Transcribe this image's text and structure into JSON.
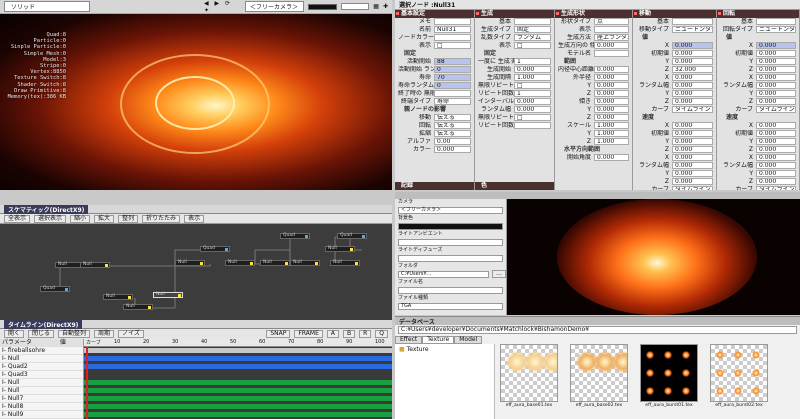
{
  "viewport": {
    "render_mode": "ソリッド",
    "camera": "＜フリーカメラ＞",
    "stats": [
      "Quad:8",
      "Particle:0",
      "Sinple Particle:0",
      "Simple Mesh:0",
      "Model:3",
      "Stripe:0",
      "Vertex:8850",
      "Texture Switch:8",
      "Shader Switch:8",
      "Draw Primitive:8",
      "Memory(tex):386 KB"
    ]
  },
  "schematic": {
    "title": "スケマティック(DirectX9)",
    "tools": [
      "全表示",
      "選択表示",
      "縮小",
      "拡大",
      "整列",
      "折りたたみ",
      "表示"
    ],
    "nodes": [
      "Null",
      "Quad",
      "Null",
      "Null",
      "Quad",
      "Null",
      "Null",
      "Null",
      "Quad",
      "Null",
      "Null",
      "Null",
      "Quad",
      "Null",
      "Null"
    ]
  },
  "timeline": {
    "title": "タイムライン(DirectX9)",
    "tools": [
      "開く",
      "閉じる",
      "自動整列",
      "周期",
      "ノイズ"
    ],
    "col_param": "パラメータ",
    "col_val": "値",
    "col_curve": "カーブ",
    "ruler": [
      "10",
      "20",
      "30",
      "40",
      "50",
      "60",
      "70",
      "80",
      "90",
      "100"
    ],
    "rows": [
      "I- fireballsohre",
      "I- Null",
      "I- Quad2",
      "I- Quad3",
      "I- Null",
      "I- Null",
      "I- Null7",
      "I- Null8",
      "I- Null9"
    ],
    "right_tools": [
      "SNAP",
      "FRAME",
      "A",
      "B",
      "R",
      "Q"
    ]
  },
  "props": {
    "header": "選択ノード :Null31",
    "col1": {
      "title": "基本設定",
      "rows": [
        [
          "メモ",
          ""
        ],
        [
          "名前",
          "Null31"
        ],
        [
          "ノードカラー",
          ""
        ],
        [
          "表示",
          "□"
        ],
        [
          "固定",
          ""
        ],
        [
          "活動開始",
          "88"
        ],
        [
          "活動開始 ランダム幅",
          "0"
        ],
        [
          "寿命",
          "70"
        ],
        [
          "寿命ランダム幅",
          "0"
        ],
        [
          "終了時の 無限ピリオド",
          ""
        ],
        [
          "終端タイプ",
          "寿命"
        ],
        [
          "親ノードの影響",
          ""
        ],
        [
          "移動",
          "伝える"
        ],
        [
          "回転",
          "伝える"
        ],
        [
          "拡縮",
          "伝える"
        ],
        [
          "アルファ",
          "0.00"
        ],
        [
          "カラー",
          "0.000"
        ]
      ],
      "sub": "記録"
    },
    "col2": {
      "title": "生成",
      "rows": [
        [
          "基本",
          ""
        ],
        [
          "生成タイプ",
          "固定"
        ],
        [
          "乱数タイプ",
          "ランダム"
        ],
        [
          "表示",
          "□"
        ],
        [
          "固定",
          ""
        ],
        [
          "一度に 生成する数",
          "1"
        ],
        [
          "生成開始",
          "0.000"
        ],
        [
          "生成間隔",
          "1.000"
        ],
        [
          "無限リピート",
          "□"
        ],
        [
          "リピート回数",
          "1"
        ],
        [
          "インターバル ランダム幅",
          "0.000"
        ],
        [
          "ランダム幅",
          "0.000"
        ],
        [
          "無限リピート",
          "□"
        ],
        [
          "リピート回数",
          ""
        ]
      ],
      "sub": "色"
    },
    "col3": {
      "title": "生成形状",
      "rows": [
        [
          "形状タイプ",
          "点"
        ],
        [
          "表示",
          ""
        ],
        [
          "生成方法",
          "座上ランダム"
        ],
        [
          "生成方向の 傾き",
          "0.000"
        ],
        [
          "モデル名",
          ""
        ],
        [
          "範囲",
          ""
        ],
        [
          "内径中心距離",
          "0.000"
        ],
        [
          "外半径",
          "0.000"
        ],
        [
          "Y",
          "0.000"
        ],
        [
          "Z",
          "0.000"
        ],
        [
          "傾き",
          "0.000"
        ],
        [
          "Y",
          "0.000"
        ],
        [
          "Z",
          "0.000"
        ],
        [
          "スケール",
          "1.000"
        ],
        [
          "Y",
          "1.000"
        ],
        [
          "Z",
          "1.000"
        ],
        [
          "水平方向範囲",
          ""
        ],
        [
          "開始角度",
          "0.000"
        ]
      ]
    },
    "col4": {
      "title": "移動",
      "rows": [
        [
          "基本",
          ""
        ],
        [
          "移動タイプ",
          "ニュートンタイプ"
        ],
        [
          "値",
          ""
        ],
        [
          "X",
          "0.000"
        ],
        [
          "初期値",
          "0.000"
        ],
        [
          "Y",
          "0.000"
        ],
        [
          "Z",
          "32.000"
        ],
        [
          "X",
          "0.000"
        ],
        [
          "ランダム幅",
          "0.000"
        ],
        [
          "Y",
          "0.000"
        ],
        [
          "Z",
          "0.000"
        ],
        [
          "カーブ",
          "タイムライン"
        ],
        [
          "速度",
          ""
        ],
        [
          "X",
          "0.000"
        ],
        [
          "初期値",
          "0.000"
        ],
        [
          "Y",
          "0.000"
        ],
        [
          "Z",
          "0.000"
        ],
        [
          "X",
          "0.000"
        ],
        [
          "ランダム幅",
          "0.000"
        ],
        [
          "Y",
          "0.000"
        ],
        [
          "Z",
          "0.000"
        ],
        [
          "カーブ",
          "タイムライン"
        ]
      ]
    },
    "col5": {
      "title": "回転",
      "rows": [
        [
          "基本",
          ""
        ],
        [
          "回転タイプ",
          "ニュートンタイプ"
        ],
        [
          "値",
          ""
        ],
        [
          "X",
          "0.000"
        ],
        [
          "初期値",
          "0.000"
        ],
        [
          "Y",
          "0.000"
        ],
        [
          "Z",
          "0.000"
        ],
        [
          "X",
          "0.000"
        ],
        [
          "ランダム幅",
          "0.000"
        ],
        [
          "Y",
          "0.000"
        ],
        [
          "Z",
          "0.000"
        ],
        [
          "カーブ",
          "タイムライン"
        ],
        [
          "速度",
          ""
        ],
        [
          "X",
          "0.000"
        ],
        [
          "初期値",
          "0.000"
        ],
        [
          "Y",
          "0.000"
        ],
        [
          "Z",
          "0.000"
        ],
        [
          "X",
          "0.000"
        ],
        [
          "ランダム幅",
          "0.000"
        ],
        [
          "Y",
          "0.000"
        ],
        [
          "Z",
          "0.000"
        ],
        [
          "カーブ",
          "タイムライン"
        ]
      ]
    }
  },
  "preview": {
    "camera_label": "カメラ",
    "camera_value": "＜フリーカメラ＞",
    "bg_label": "背景色",
    "light_label": "ライトアンビエント",
    "diffuse_label": "ライトディフューズ",
    "folder_label": "フォルダ",
    "folder_value": "C:¥Users¥...",
    "file_label": "ファイル名",
    "type_label": "ファイル種類",
    "type_value": "TGA"
  },
  "assets": {
    "title": "データベース",
    "path": "C:¥Users¥developer¥Documents¥Matchlock¥BishamonDemo¥",
    "tabs": [
      "Effect",
      "Texture",
      "Model"
    ],
    "folder": "Texture",
    "thumbs": [
      "eff_aura_base01.tex",
      "eff_aura_base02.tex",
      "eff_aura_burst01.tex",
      "eff_aura_burst02.tex"
    ]
  }
}
